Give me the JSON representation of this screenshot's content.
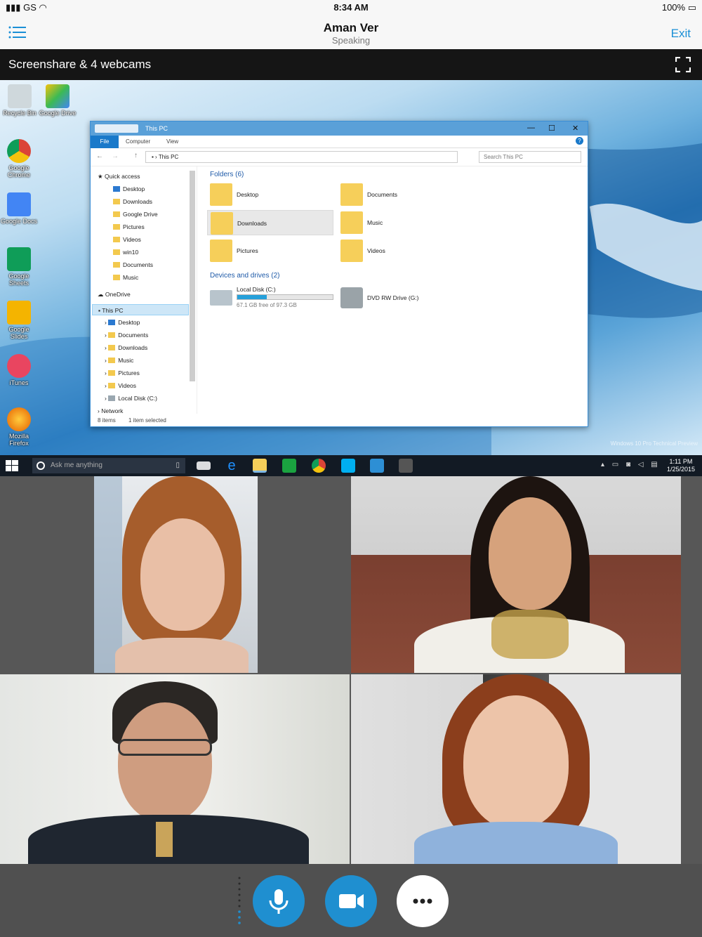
{
  "status_bar": {
    "carrier": "GS",
    "time": "8:34 AM",
    "battery": "100%"
  },
  "nav": {
    "title": "Aman Ver",
    "subtitle": "Speaking",
    "exit_label": "Exit"
  },
  "share": {
    "label": "Screenshare & 4 webcams"
  },
  "desktop": {
    "icons": [
      "Recycle Bin",
      "Google Drive",
      "Google Chrome",
      "Google Docs",
      "Google Sheets",
      "Google Slides",
      "iTunes",
      "Mozilla Firefox"
    ],
    "watermark": "Windows 10 Pro Technical Preview"
  },
  "explorer": {
    "window_title": "This PC",
    "ribbon_tabs": [
      "File",
      "Computer",
      "View"
    ],
    "address": "This PC",
    "search_placeholder": "Search This PC",
    "nav_items": [
      "Quick access",
      "Desktop",
      "Downloads",
      "Google Drive",
      "Pictures",
      "Videos",
      "win10",
      "Documents",
      "Music",
      "OneDrive",
      "This PC",
      "Desktop",
      "Documents",
      "Downloads",
      "Music",
      "Pictures",
      "Videos",
      "Local Disk (C:)",
      "Network"
    ],
    "folders_header": "Folders (6)",
    "folders": [
      "Desktop",
      "Documents",
      "Downloads",
      "Music",
      "Pictures",
      "Videos"
    ],
    "devices_header": "Devices and drives (2)",
    "drive_c": {
      "name": "Local Disk (C:)",
      "free": "67.1 GB free of 97.3 GB",
      "used_fraction": 0.31
    },
    "drive_g": {
      "name": "DVD RW Drive (G:)"
    },
    "status_items": "8 items",
    "status_selected": "1 item selected"
  },
  "taskbar": {
    "search_placeholder": "Ask me anything",
    "time": "1:11 PM",
    "date": "1/25/2015"
  },
  "colors": {
    "accent": "#1a8fd6",
    "control_blue": "#1f8fd0"
  }
}
